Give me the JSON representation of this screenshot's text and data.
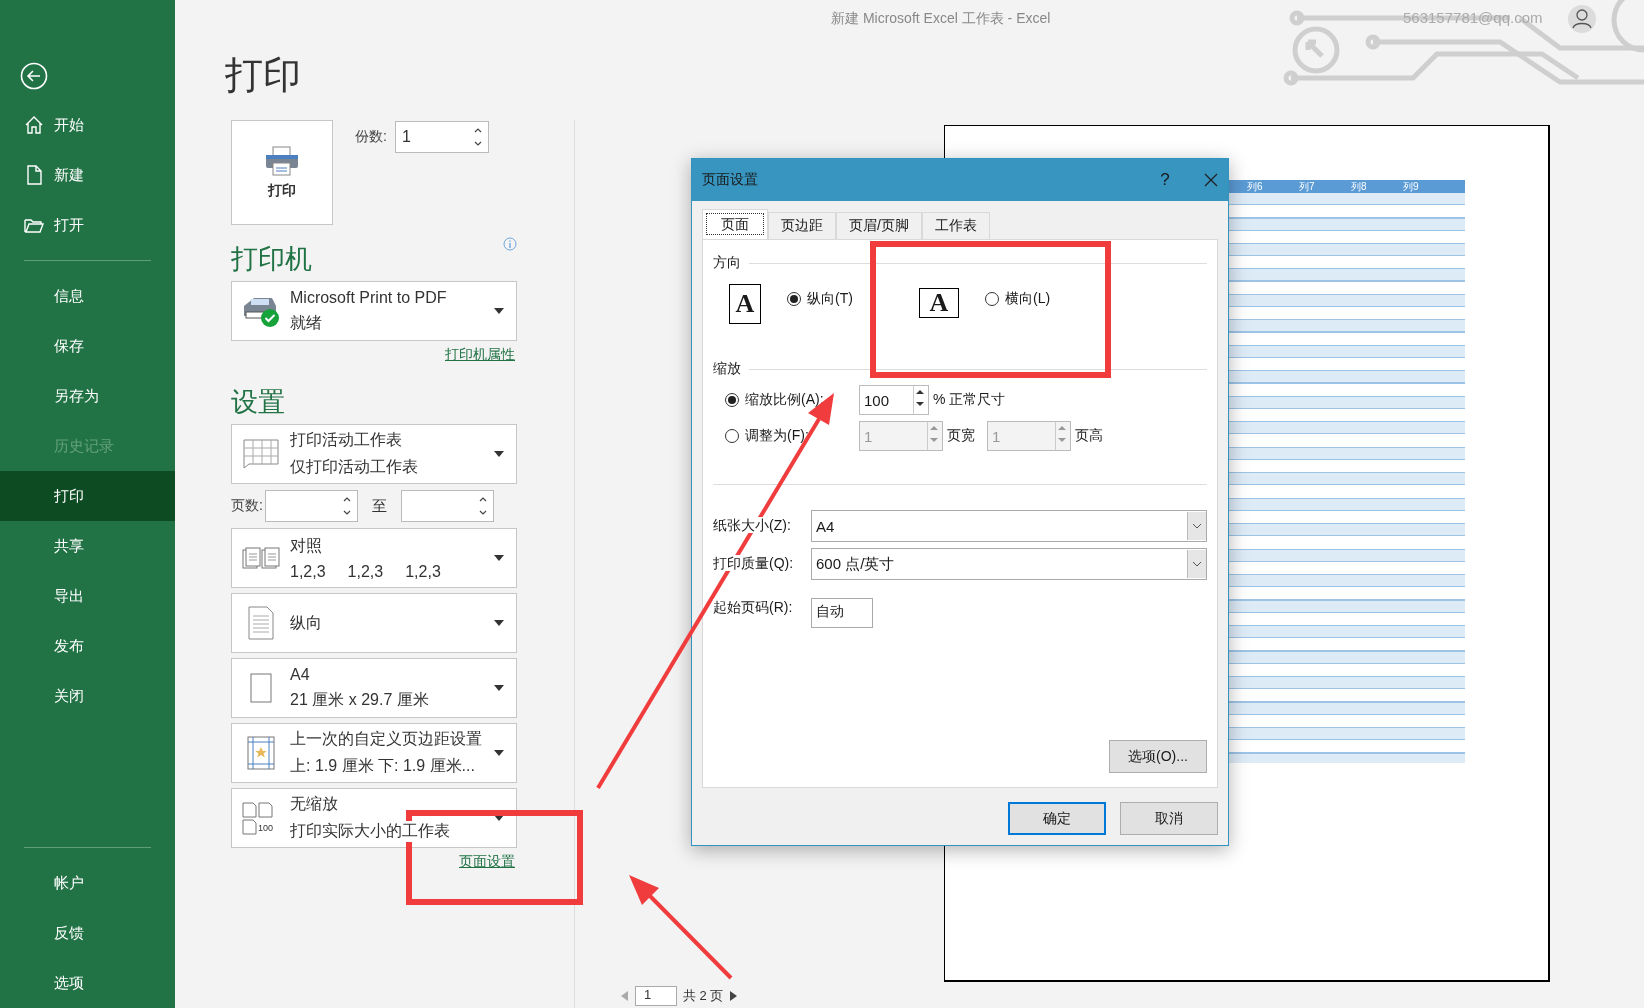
{
  "window": {
    "title": "新建 Microsoft Excel 工作表  -  Excel",
    "account": "563157781@qq.com"
  },
  "sidebar": {
    "sections": [
      {
        "items": [
          {
            "label": "开始",
            "kind": "home",
            "selected": false,
            "disabled": false
          },
          {
            "label": "新建",
            "kind": "new",
            "selected": false,
            "disabled": false
          },
          {
            "label": "打开",
            "kind": "open",
            "selected": false,
            "disabled": false
          }
        ]
      },
      {
        "items": [
          {
            "label": "信息",
            "kind": "text",
            "selected": false,
            "disabled": false
          },
          {
            "label": "保存",
            "kind": "text",
            "selected": false,
            "disabled": false
          },
          {
            "label": "另存为",
            "kind": "text",
            "selected": false,
            "disabled": false
          },
          {
            "label": "历史记录",
            "kind": "text",
            "selected": false,
            "disabled": true
          },
          {
            "label": "打印",
            "kind": "text",
            "selected": true,
            "disabled": false
          },
          {
            "label": "共享",
            "kind": "text",
            "selected": false,
            "disabled": false
          },
          {
            "label": "导出",
            "kind": "text",
            "selected": false,
            "disabled": false
          },
          {
            "label": "发布",
            "kind": "text",
            "selected": false,
            "disabled": false
          },
          {
            "label": "关闭",
            "kind": "text",
            "selected": false,
            "disabled": false
          }
        ]
      },
      {
        "items": [
          {
            "label": "帐户",
            "kind": "text",
            "selected": false,
            "disabled": false
          },
          {
            "label": "反馈",
            "kind": "text",
            "selected": false,
            "disabled": false
          },
          {
            "label": "选项",
            "kind": "text",
            "selected": false,
            "disabled": false
          }
        ]
      }
    ]
  },
  "print": {
    "heading": "打印",
    "button": "打印",
    "copies_label": "份数:",
    "copies": "1"
  },
  "printer": {
    "heading": "打印机",
    "name": "Microsoft Print to PDF",
    "status": "就绪",
    "properties_link": "打印机属性"
  },
  "settings": {
    "heading": "设置",
    "scope": {
      "kind": "sheet",
      "title": "打印活动工作表",
      "subtitle": "仅打印活动工作表"
    },
    "pages": {
      "label": "页数:",
      "to": "至"
    },
    "options": [
      {
        "kind": "collate",
        "title": "对照",
        "parts": [
          "1,2,3",
          "1,2,3",
          "1,2,3"
        ]
      },
      {
        "kind": "portrait",
        "title": "纵向"
      },
      {
        "kind": "paper",
        "title": "A4",
        "subtitle": "21 厘米 x 29.7 厘米"
      },
      {
        "kind": "margins",
        "title": "上一次的自定义页边距设置",
        "subtitle": "上: 1.9 厘米 下: 1.9 厘米..."
      },
      {
        "kind": "scaling",
        "title": "无缩放",
        "subtitle": "打印实际大小的工作表",
        "badge": "100"
      }
    ],
    "page_setup_link": "页面设置"
  },
  "preview": {
    "column_headers": [
      "列6",
      "列7",
      "列8",
      "列9"
    ]
  },
  "page_nav": {
    "page": "1",
    "total": "共 2 页"
  },
  "dialog": {
    "title": "页面设置",
    "help": "?",
    "tabs": [
      {
        "label": "页面",
        "selected": true
      },
      {
        "label": "页边距",
        "selected": false
      },
      {
        "label": "页眉/页脚",
        "selected": false
      },
      {
        "label": "工作表",
        "selected": false
      }
    ],
    "orientation": {
      "label": "方向",
      "options": [
        {
          "kind": "portrait",
          "glyph": "A",
          "label": "纵向(T)",
          "selected": true
        },
        {
          "kind": "landscape",
          "glyph": "A",
          "label": "横向(L)",
          "selected": false
        }
      ]
    },
    "scaling": {
      "label": "缩放",
      "options": [
        {
          "label": "缩放比例(A):",
          "selected": true,
          "fields": [
            {
              "value": "100",
              "unit": "% 正常尺寸"
            }
          ]
        },
        {
          "label": "调整为(F):",
          "selected": false,
          "fields": [
            {
              "value": "1",
              "unit": "页宽"
            },
            {
              "value": "1",
              "unit": "页高"
            }
          ]
        }
      ]
    },
    "fields": [
      {
        "kind": "select",
        "label": "纸张大小(Z):",
        "value": "A4"
      },
      {
        "kind": "select",
        "label": "打印质量(Q):",
        "value": "600 点/英寸"
      },
      {
        "kind": "text",
        "label": "起始页码(R):",
        "value": "自动"
      }
    ],
    "options_button": "选项(O)...",
    "buttons": [
      {
        "label": "确定",
        "default": true
      },
      {
        "label": "取消",
        "default": false
      }
    ]
  }
}
